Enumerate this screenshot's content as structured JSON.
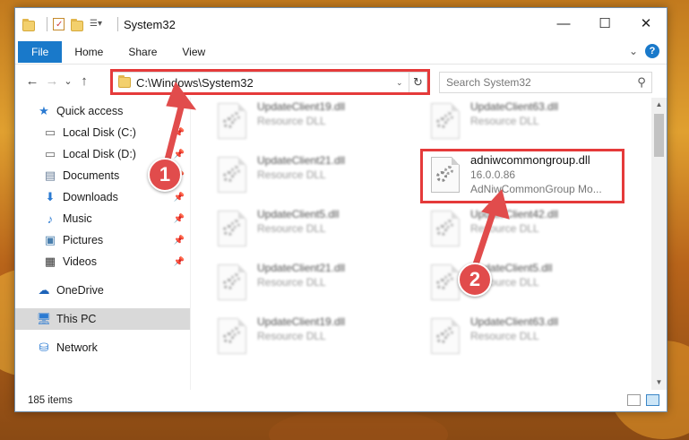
{
  "window": {
    "title": "System32",
    "min_glyph": "—",
    "max_glyph": "☐",
    "close_glyph": "✕"
  },
  "ribbon": {
    "tabs": [
      "File",
      "Home",
      "Share",
      "View"
    ],
    "help_glyph": "?",
    "collapse_glyph": "⌄"
  },
  "nav_glyphs": {
    "back": "←",
    "forward": "→",
    "recent": "⌄",
    "up": "↑"
  },
  "address": {
    "path": "C:\\Windows\\System32",
    "dropdown_glyph": "⌄",
    "refresh_glyph": "↻"
  },
  "search": {
    "placeholder": "Search System32",
    "icon": "search-icon"
  },
  "sidebar": {
    "items": [
      {
        "label": "Quick access",
        "icon": "star-icon",
        "pinned": false
      },
      {
        "label": "Local Disk (C:)",
        "icon": "drive-icon",
        "pinned": true
      },
      {
        "label": "Local Disk (D:)",
        "icon": "drive-icon",
        "pinned": true
      },
      {
        "label": "Documents",
        "icon": "documents-icon",
        "pinned": true
      },
      {
        "label": "Downloads",
        "icon": "download-icon",
        "pinned": true
      },
      {
        "label": "Music",
        "icon": "music-icon",
        "pinned": true
      },
      {
        "label": "Pictures",
        "icon": "pictures-icon",
        "pinned": true
      },
      {
        "label": "Videos",
        "icon": "videos-icon",
        "pinned": true
      },
      {
        "label": "OneDrive",
        "icon": "cloud-icon",
        "pinned": false
      },
      {
        "label": "This PC",
        "icon": "computer-icon",
        "pinned": false
      },
      {
        "label": "Network",
        "icon": "network-icon",
        "pinned": false
      }
    ]
  },
  "files": [
    {
      "name": "UpdateClient19.dll",
      "type": "Resource DLL"
    },
    {
      "name": "UpdateClient63.dll",
      "type": "Resource DLL"
    },
    {
      "name": "UpdateClient21.dll",
      "type": "Resource DLL"
    },
    {
      "name": "adniwcommongroup.dll",
      "version": "16.0.0.86",
      "description": "AdNiwCommonGroup Mo..."
    },
    {
      "name": "UpdateClient5.dll",
      "type": "Resource DLL"
    },
    {
      "name": "UpdateClient42.dll",
      "type": "Resource DLL"
    },
    {
      "name": "UpdateClient21.dll",
      "type": "Resource DLL"
    },
    {
      "name": "UpdateClient5.dll",
      "type": "Resource DLL"
    },
    {
      "name": "UpdateClient19.dll",
      "type": "Resource DLL"
    },
    {
      "name": "UpdateClient63.dll",
      "type": "Resource DLL"
    }
  ],
  "status": {
    "item_count": "185 items"
  },
  "annotations": {
    "step1": "1",
    "step2": "2",
    "color": "#e14c4c"
  }
}
